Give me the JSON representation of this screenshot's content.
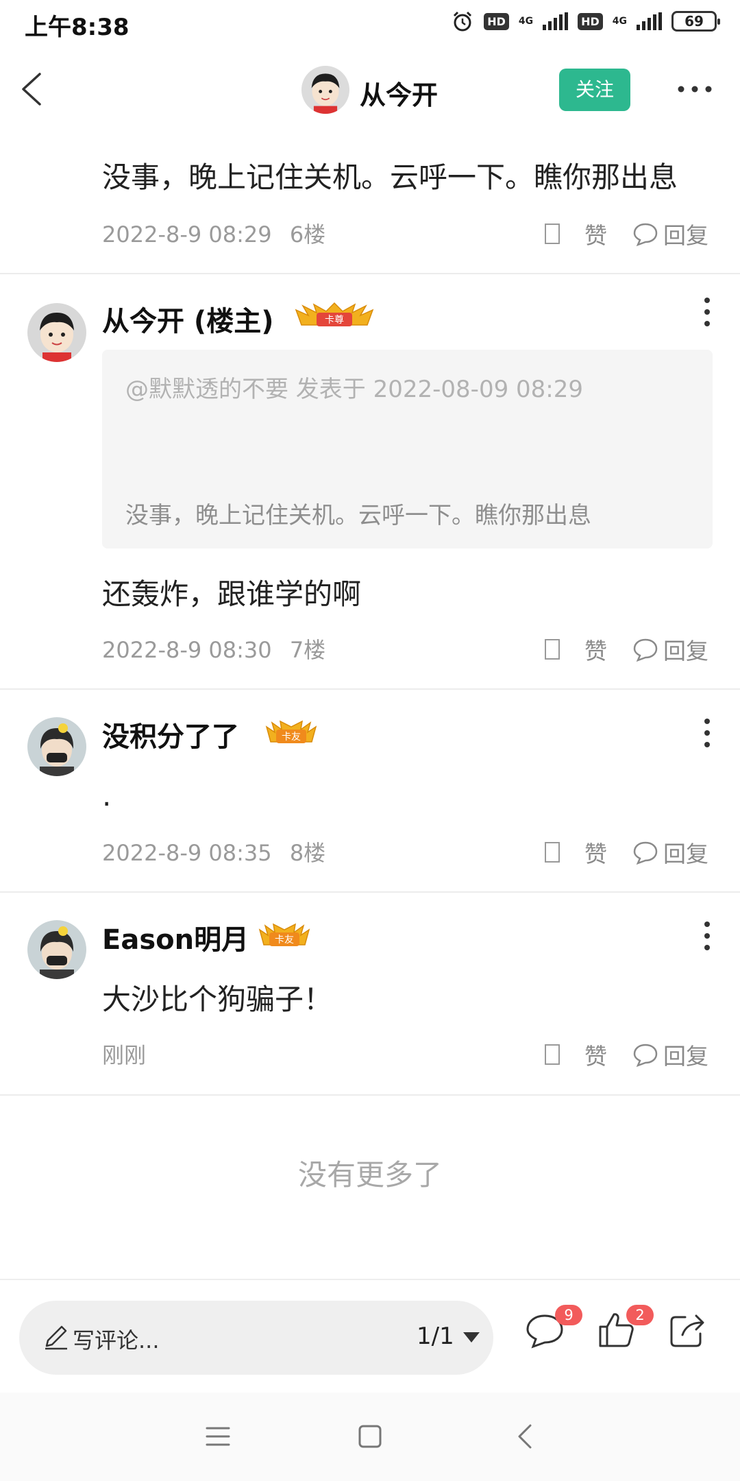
{
  "status_bar": {
    "time": "上午8:38",
    "hd1": "HD",
    "net1": "4G",
    "hd2": "HD",
    "net2": "4G",
    "battery": "69"
  },
  "header": {
    "title": "从今开",
    "follow_label": "关注",
    "back_icon": "chevron-left-icon",
    "more_icon": "more-horizontal-icon"
  },
  "comments": [
    {
      "text": "没事，晚上记住关机。云呼一下。瞧你那出息",
      "time": "2022-8-9 08:29",
      "floor": "6楼",
      "like_label": "赞",
      "reply_label": "回复"
    },
    {
      "username": "从今开 (楼主)",
      "badge": "卡尊",
      "quote_head": "@默默透的不要 发表于 2022-08-09 08:29",
      "quote_body": "没事，晚上记住关机。云呼一下。瞧你那出息",
      "text": "还轰炸，跟谁学的啊",
      "time": "2022-8-9 08:30",
      "floor": "7楼",
      "like_label": "赞",
      "reply_label": "回复"
    },
    {
      "username": "没积分了了",
      "badge": "卡友",
      "text": ".",
      "time": "2022-8-9 08:35",
      "floor": "8楼",
      "like_label": "赞",
      "reply_label": "回复"
    },
    {
      "username": "Eason明月",
      "badge": "卡友",
      "text": "大沙比个狗骗子！",
      "time": "刚刚",
      "like_label": "赞",
      "reply_label": "回复"
    }
  ],
  "no_more": "没有更多了",
  "bottom_bar": {
    "write_placeholder": "写评论...",
    "page": "1/1",
    "comment_count": "9",
    "like_count": "2"
  },
  "colors": {
    "accent": "#2db88f",
    "badge_red": "#f25b5b",
    "muted_text": "#9a9a9a"
  }
}
